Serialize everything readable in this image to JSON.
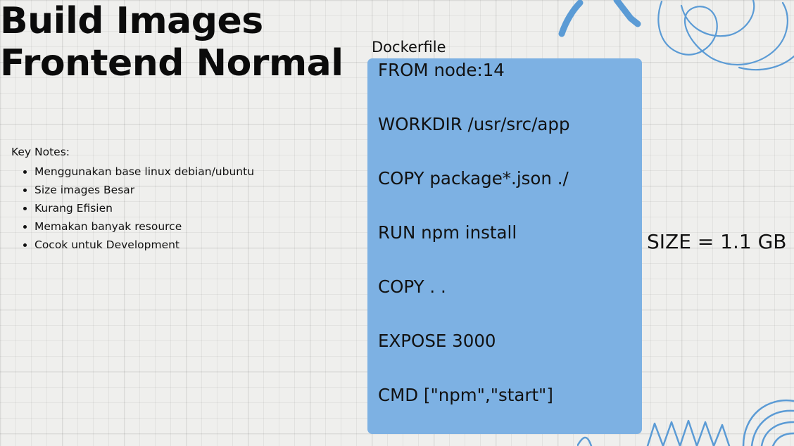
{
  "title": {
    "line1": "Build Images",
    "line2": "Frontend Normal"
  },
  "key_notes": {
    "heading": "Key Notes:",
    "items": [
      "Menggunakan base linux debian/ubuntu",
      "Size images Besar",
      "Kurang Efisien",
      "Memakan banyak resource",
      "Cocok untuk Development"
    ]
  },
  "dockerfile": {
    "label": "Dockerfile",
    "lines": [
      "FROM node:14",
      "WORKDIR /usr/src/app",
      "COPY package*.json ./",
      "RUN npm install",
      "COPY . .",
      "EXPOSE 3000",
      "CMD [\"npm\",\"start\"]"
    ]
  },
  "size": "SIZE = 1.1 GB",
  "colors": {
    "code_box": "#7db1e3",
    "doodle": "#5b9bd5",
    "background": "#efefed"
  }
}
